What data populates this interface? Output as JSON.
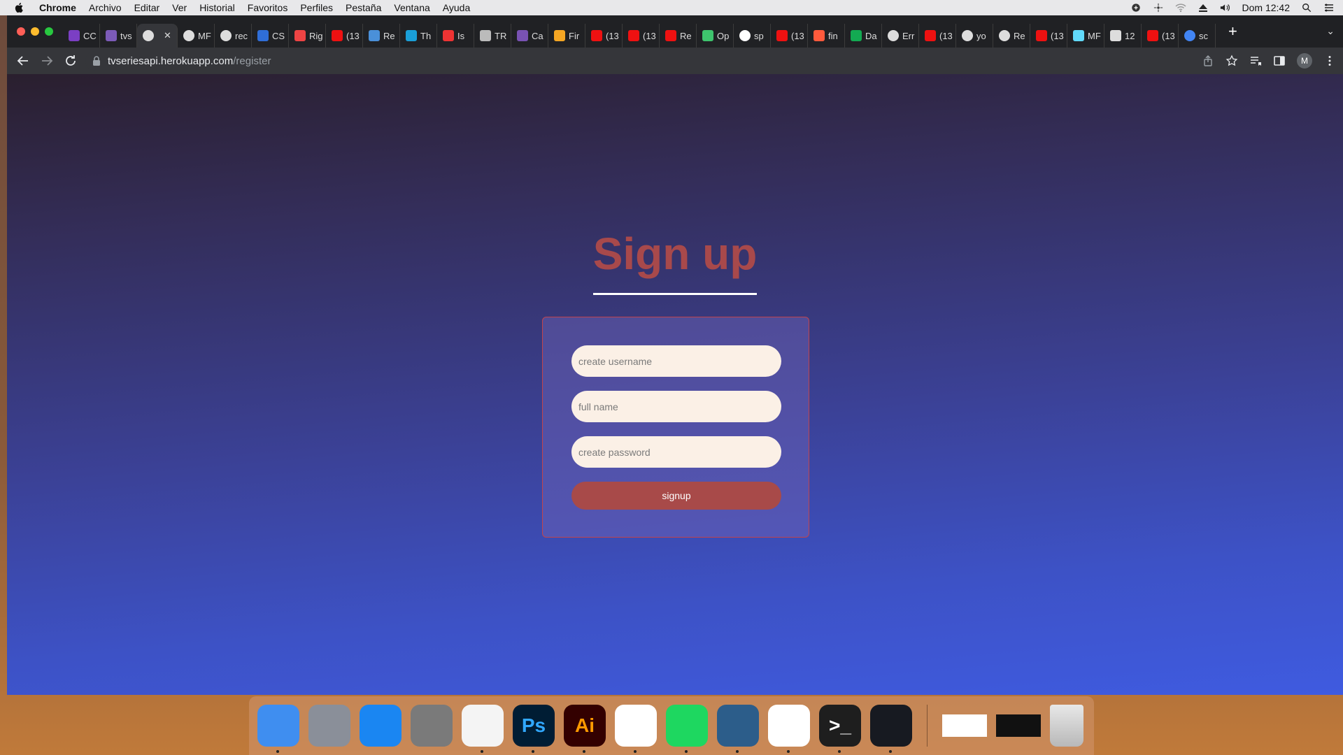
{
  "menubar": {
    "app_name": "Chrome",
    "menus": [
      "Archivo",
      "Editar",
      "Ver",
      "Historial",
      "Favoritos",
      "Perfiles",
      "Pestaña",
      "Ventana",
      "Ayuda"
    ],
    "clock": "Dom 12:42"
  },
  "browser": {
    "tabs": [
      {
        "label": "CC",
        "icon": "onenote-icon",
        "color": "#7b3fc4"
      },
      {
        "label": "tvs",
        "icon": "heroku-icon",
        "color": "#7c5bb8"
      },
      {
        "label": "",
        "icon": "globe-icon",
        "color": "#dddddd",
        "active": true
      },
      {
        "label": "MF",
        "icon": "github-icon",
        "color": "#dddddd"
      },
      {
        "label": "rec",
        "icon": "github-icon",
        "color": "#dddddd"
      },
      {
        "label": "CS",
        "icon": "css-icon",
        "color": "#2f6ed8"
      },
      {
        "label": "Rig",
        "icon": "figma-icon",
        "color": "#e44"
      },
      {
        "label": "(13",
        "icon": "youtube-icon",
        "color": "#e11"
      },
      {
        "label": "Re",
        "icon": "sparkle-icon",
        "color": "#4a90d9"
      },
      {
        "label": "Th",
        "icon": "bar-icon",
        "color": "#1a9fd8"
      },
      {
        "label": "Is",
        "icon": "bracket-icon",
        "color": "#e33"
      },
      {
        "label": "TR",
        "icon": "octopus-icon",
        "color": "#bbbbbb"
      },
      {
        "label": "Ca",
        "icon": "bootstrap-icon",
        "color": "#7952b3"
      },
      {
        "label": "Fir",
        "icon": "firebase-icon",
        "color": "#f5a623"
      },
      {
        "label": "(13",
        "icon": "youtube-icon",
        "color": "#e11"
      },
      {
        "label": "(13",
        "icon": "youtube-icon",
        "color": "#e11"
      },
      {
        "label": "Re",
        "icon": "youtube-icon",
        "color": "#e11"
      },
      {
        "label": "Op",
        "icon": "diamond-icon",
        "color": "#3ec46d"
      },
      {
        "label": "sp",
        "icon": "spotify-icon",
        "color": "#ffffff"
      },
      {
        "label": "(13",
        "icon": "youtube-icon",
        "color": "#e11"
      },
      {
        "label": "fin",
        "icon": "compass-icon",
        "color": "#ff5a3c"
      },
      {
        "label": "Da",
        "icon": "leaf-icon",
        "color": "#13aa52"
      },
      {
        "label": "Err",
        "icon": "globe-icon",
        "color": "#dddddd"
      },
      {
        "label": "(13",
        "icon": "youtube-icon",
        "color": "#e11"
      },
      {
        "label": "yo",
        "icon": "github-icon",
        "color": "#dddddd"
      },
      {
        "label": "Re",
        "icon": "globe-icon",
        "color": "#dddddd"
      },
      {
        "label": "(13",
        "icon": "youtube-icon",
        "color": "#e11"
      },
      {
        "label": "MF",
        "icon": "react-icon",
        "color": "#61dafb"
      },
      {
        "label": "12",
        "icon": "calendar-icon",
        "color": "#dddddd"
      },
      {
        "label": "(13",
        "icon": "youtube-icon",
        "color": "#e11"
      },
      {
        "label": "sc",
        "icon": "google-icon",
        "color": "#4285f4"
      }
    ],
    "url_host": "tvseriesapi.herokuapp.com",
    "url_path": "/register",
    "profile_initial": "M"
  },
  "page": {
    "title": "Sign up",
    "form": {
      "username_placeholder": "create username",
      "fullname_placeholder": "full name",
      "password_placeholder": "create password",
      "submit_label": "signup"
    },
    "colors": {
      "title": "#a8494b",
      "button": "#a84a49",
      "field_bg": "#fbf0e6",
      "card_border": "#c0444e"
    }
  },
  "dock": {
    "items": [
      {
        "name": "finder",
        "label": "",
        "bg": "#3f8ef0",
        "fg": "#ffffff",
        "running": true
      },
      {
        "name": "launchpad",
        "label": "",
        "bg": "#8a8f99",
        "fg": "#ffffff",
        "running": false
      },
      {
        "name": "app-store",
        "label": "",
        "bg": "#1a86f2",
        "fg": "#ffffff",
        "running": false
      },
      {
        "name": "system-preferences",
        "label": "",
        "bg": "#7a7a7a",
        "fg": "#ffffff",
        "running": false
      },
      {
        "name": "chrome",
        "label": "",
        "bg": "#f4f4f4",
        "fg": "#db4437",
        "running": true
      },
      {
        "name": "photoshop",
        "label": "Ps",
        "bg": "#001d34",
        "fg": "#31a8ff",
        "running": true
      },
      {
        "name": "illustrator",
        "label": "Ai",
        "bg": "#330000",
        "fg": "#ff9a00",
        "running": true
      },
      {
        "name": "vscode",
        "label": "",
        "bg": "#ffffff",
        "fg": "#0078d4",
        "running": true
      },
      {
        "name": "spotify",
        "label": "",
        "bg": "#1ed760",
        "fg": "#000000",
        "running": true
      },
      {
        "name": "mysql-workbench",
        "label": "",
        "bg": "#2c5d8a",
        "fg": "#ffffff",
        "running": true
      },
      {
        "name": "safari",
        "label": "",
        "bg": "#ffffff",
        "fg": "#1a86f2",
        "running": true
      },
      {
        "name": "terminal",
        "label": ">_",
        "bg": "#1e1e1e",
        "fg": "#ffffff",
        "running": true
      },
      {
        "name": "steam",
        "label": "",
        "bg": "#171a21",
        "fg": "#ffffff",
        "running": true
      }
    ],
    "trash_name": "trash"
  }
}
